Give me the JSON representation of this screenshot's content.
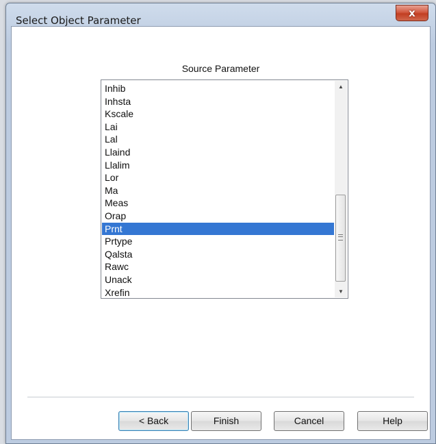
{
  "window": {
    "title": "Select Object Parameter",
    "close_glyph": "x"
  },
  "dialog": {
    "section_label": "Source Parameter"
  },
  "list": {
    "items": [
      "Inhib",
      "Inhsta",
      "Kscale",
      "Lai",
      "Lal",
      "Llaind",
      "Llalim",
      "Lor",
      "Ma",
      "Meas",
      "Orap",
      "Prnt",
      "Prtype",
      "Qalsta",
      "Rawc",
      "Unack",
      "Xrefin"
    ],
    "selected": "Prnt"
  },
  "scrollbar": {
    "up_icon": "chevron-up-icon",
    "down_icon": "chevron-down-icon",
    "grip_icon": "grip-icon"
  },
  "buttons": {
    "back_label": "< Back",
    "finish_label": "Finish",
    "cancel_label": "Cancel",
    "help_label": "Help"
  },
  "colors": {
    "selection": "#3477d3",
    "close_button": "#c23e22"
  }
}
